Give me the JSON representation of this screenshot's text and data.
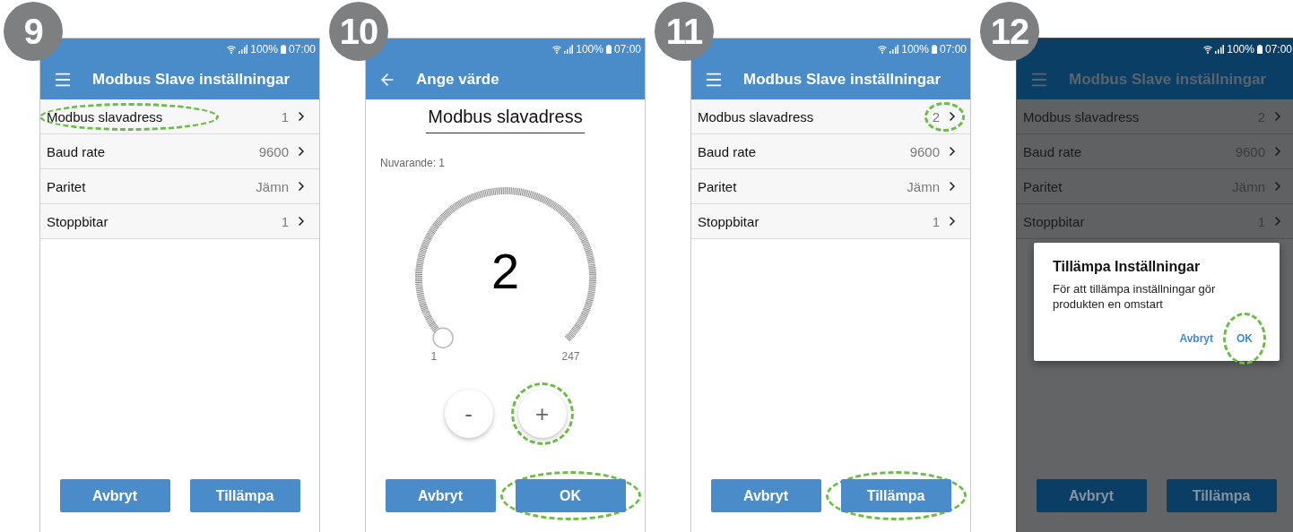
{
  "steps": [
    {
      "number": "9",
      "kind": "list",
      "dimmed": false,
      "status": {
        "battery": "100%",
        "time": "07:00"
      },
      "app_bar": {
        "kind": "menu",
        "title": "Modbus Slave inställningar"
      },
      "rows": [
        {
          "label": "Modbus slavadress",
          "value": "1",
          "label_highlighted": true,
          "value_highlighted": false
        },
        {
          "label": "Baud rate",
          "value": "9600",
          "label_highlighted": false,
          "value_highlighted": false
        },
        {
          "label": "Paritet",
          "value": "Jämn",
          "label_highlighted": false,
          "value_highlighted": false
        },
        {
          "label": "Stoppbitar",
          "value": "1",
          "label_highlighted": false,
          "value_highlighted": false
        }
      ],
      "buttons": [
        {
          "label": "Avbryt",
          "highlighted": false
        },
        {
          "label": "Tillämpa",
          "highlighted": false
        }
      ]
    },
    {
      "number": "10",
      "kind": "dial",
      "dimmed": false,
      "status": {
        "battery": "100%",
        "time": "07:00"
      },
      "app_bar": {
        "kind": "back",
        "title": "Ange värde"
      },
      "dial": {
        "heading": "Modbus slavadress",
        "current": "Nuvarande: 1",
        "value": "2",
        "min": "1",
        "max": "247",
        "steppers": [
          {
            "label": "-",
            "highlighted": false
          },
          {
            "label": "+",
            "highlighted": true
          }
        ]
      },
      "buttons": [
        {
          "label": "Avbryt",
          "highlighted": false
        },
        {
          "label": "OK",
          "highlighted": true
        }
      ]
    },
    {
      "number": "11",
      "kind": "list",
      "dimmed": false,
      "status": {
        "battery": "100%",
        "time": "07:00"
      },
      "app_bar": {
        "kind": "menu",
        "title": "Modbus Slave inställningar"
      },
      "rows": [
        {
          "label": "Modbus slavadress",
          "value": "2",
          "label_highlighted": false,
          "value_highlighted": true
        },
        {
          "label": "Baud rate",
          "value": "9600",
          "label_highlighted": false,
          "value_highlighted": false
        },
        {
          "label": "Paritet",
          "value": "Jämn",
          "label_highlighted": false,
          "value_highlighted": false
        },
        {
          "label": "Stoppbitar",
          "value": "1",
          "label_highlighted": false,
          "value_highlighted": false
        }
      ],
      "buttons": [
        {
          "label": "Avbryt",
          "highlighted": false
        },
        {
          "label": "Tillämpa",
          "highlighted": true
        }
      ]
    },
    {
      "number": "12",
      "kind": "list",
      "dimmed": true,
      "status": {
        "battery": "100%",
        "time": "07:00"
      },
      "app_bar": {
        "kind": "menu",
        "title": "Modbus Slave inställningar"
      },
      "rows": [
        {
          "label": "Modbus slavadress",
          "value": "2",
          "label_highlighted": false,
          "value_highlighted": false
        },
        {
          "label": "Baud rate",
          "value": "9600",
          "label_highlighted": false,
          "value_highlighted": false
        },
        {
          "label": "Paritet",
          "value": "Jämn",
          "label_highlighted": false,
          "value_highlighted": false
        },
        {
          "label": "Stoppbitar",
          "value": "1",
          "label_highlighted": false,
          "value_highlighted": false
        }
      ],
      "buttons": [
        {
          "label": "Avbryt",
          "highlighted": false
        },
        {
          "label": "Tillämpa",
          "highlighted": false
        }
      ],
      "dialog": {
        "title": "Tillämpa Inställningar",
        "message": "För att tillämpa inställningar gör produkten en omstart",
        "buttons": [
          {
            "label": "Avbryt",
            "highlighted": false
          },
          {
            "label": "OK",
            "highlighted": true
          }
        ]
      }
    }
  ]
}
